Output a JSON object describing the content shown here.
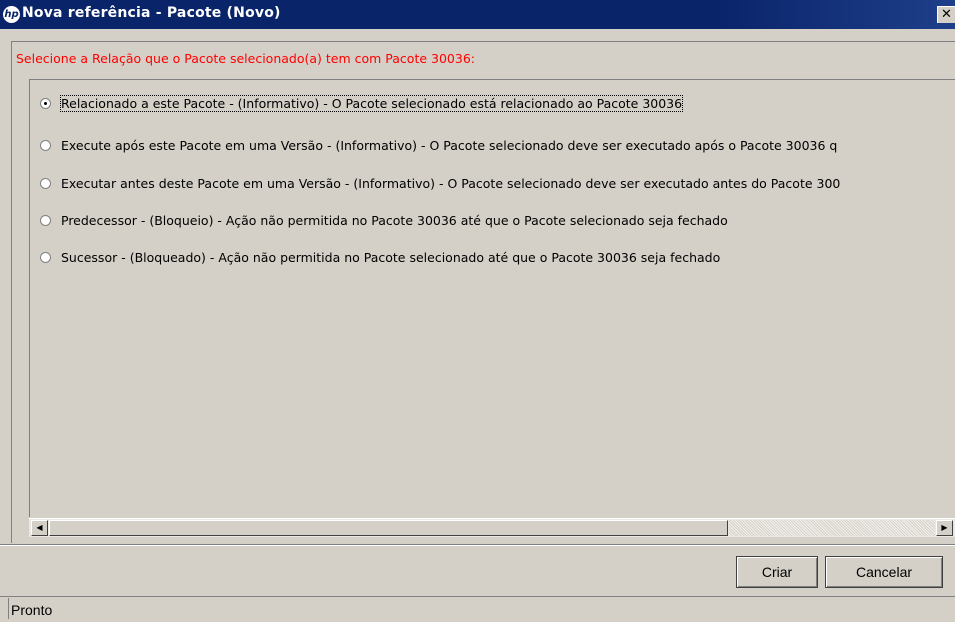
{
  "window": {
    "title": "Nova referência - Pacote (Novo)",
    "logo_text": "hp",
    "close_glyph": "✕"
  },
  "prompt": "Selecione a Relação que o Pacote selecionado(a) tem com Pacote 30036:",
  "options": [
    {
      "label": "Relacionado a este Pacote - (Informativo) - O Pacote selecionado está relacionado ao Pacote 30036",
      "selected": true
    },
    {
      "label": "Execute após este Pacote em uma Versão - (Informativo) - O Pacote selecionado deve ser executado após o Pacote 30036 q",
      "selected": false
    },
    {
      "label": "Executar antes deste Pacote em uma Versão - (Informativo) - O Pacote selecionado deve ser executado antes do Pacote 300",
      "selected": false
    },
    {
      "label": "Predecessor - (Bloqueio) - Ação não permitida no Pacote 30036 até que o Pacote selecionado seja fechado",
      "selected": false
    },
    {
      "label": "Sucessor - (Bloqueado) - Ação não permitida no Pacote selecionado até que o Pacote 30036 seja fechado",
      "selected": false
    }
  ],
  "buttons": {
    "create": "Criar",
    "cancel": "Cancelar"
  },
  "status": "Pronto",
  "colors": {
    "titlebar": "#0a246a",
    "prompt": "#ff0000",
    "face": "#d4d0c8"
  }
}
